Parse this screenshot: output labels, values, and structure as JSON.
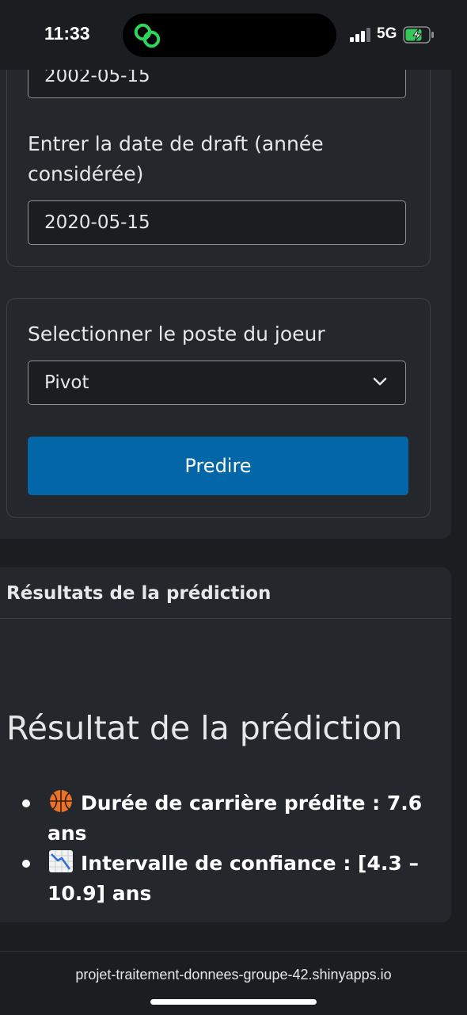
{
  "status_bar": {
    "time": "11:33",
    "network": "5G",
    "icons": [
      "link-icon",
      "signal-icon",
      "battery-charging-icon"
    ]
  },
  "form": {
    "birth_date_value": "2002-05-15",
    "draft_date_label": "Entrer la date de draft (année considérée)",
    "draft_date_value": "2020-05-15",
    "position_label": "Selectionner le poste du joeur",
    "position_selected": "Pivot",
    "predict_button": "Predire"
  },
  "results": {
    "header": "Résultats de la prédiction",
    "title": "Résultat de la prédiction",
    "items": [
      {
        "icon": "basketball-icon",
        "text": "Durée de carrière prédite : 7.6 ans"
      },
      {
        "icon": "chart-decreasing-icon",
        "text": "Intervalle de confiance : [4.3 – 10.9] ans"
      }
    ]
  },
  "browser": {
    "url": "projet-traitement-donnees-groupe-42.shinyapps.io"
  },
  "colors": {
    "background": "#1b1d20",
    "card": "#24272b",
    "button": "#0366a8",
    "text": "#e6e7e8"
  }
}
